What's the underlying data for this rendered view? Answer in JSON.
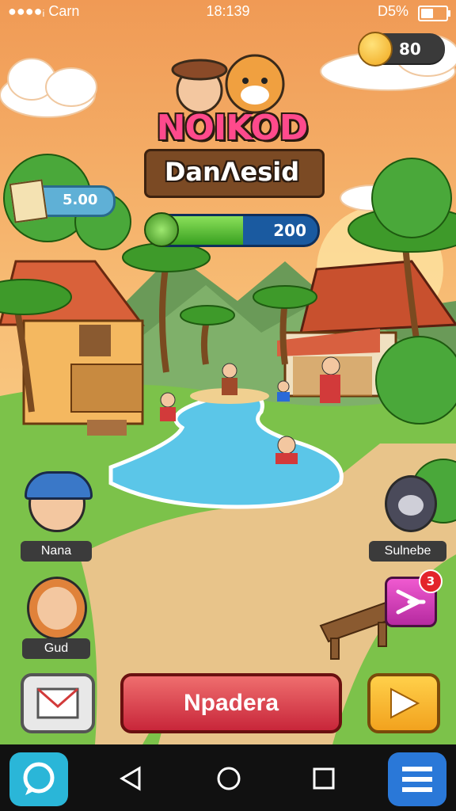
{
  "status_bar": {
    "carrier": "●●●●ᵢ Carn",
    "time": "18:139",
    "battery_text": "D5%",
    "battery_level": 0.55
  },
  "hud": {
    "coins": "80",
    "energy": "5.00",
    "progress_value": "200",
    "progress_fraction": 0.56
  },
  "title": {
    "line1": "NOIKOD",
    "line2": "DanΛesid"
  },
  "characters": [
    {
      "name": "Nana"
    },
    {
      "name": "Gud"
    },
    {
      "name": "Sulnebe"
    }
  ],
  "actions": {
    "main_button": "Npadera",
    "special_badge": "3"
  },
  "icons": {
    "mail": "mail-icon",
    "play": "play-icon",
    "special": "arrow-burst-icon",
    "app": "chat-bubble-icon",
    "back": "back-icon",
    "home": "home-icon",
    "recents": "recents-icon",
    "menu": "menu-icon"
  }
}
